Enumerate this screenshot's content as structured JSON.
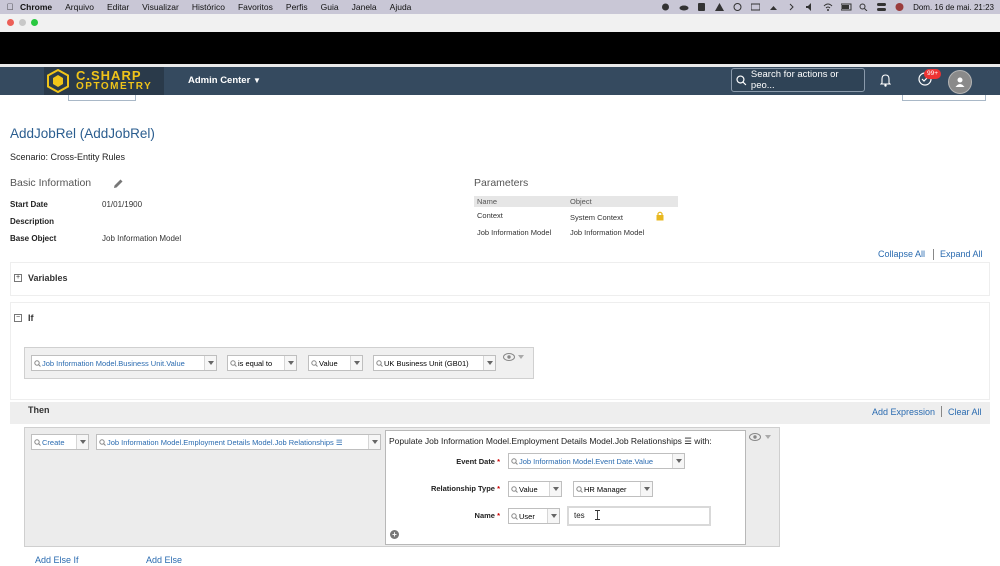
{
  "menubar": {
    "items": [
      "Chrome",
      "Arquivo",
      "Editar",
      "Visualizar",
      "Histórico",
      "Favoritos",
      "Perfis",
      "Guia",
      "Janela",
      "Ajuda"
    ],
    "clock": "Dom. 16 de mai.  21:23"
  },
  "shell": {
    "logo_line1": "C.SHARP",
    "logo_line2": "OPTOMETRY",
    "admin_center": "Admin Center",
    "search_placeholder": "Search for actions or peo...",
    "notification_badge": "99+",
    "brand_color": "#354a5f",
    "logo_color": "#f0c419"
  },
  "rule": {
    "title": "AddJobRel (AddJobRel)",
    "scenario": "Scenario: Cross-Entity Rules"
  },
  "basic_info": {
    "heading": "Basic Information",
    "start_date_label": "Start Date",
    "start_date": "01/01/1900",
    "description_label": "Description",
    "base_object_label": "Base Object",
    "base_object": "Job Information Model"
  },
  "parameters": {
    "heading": "Parameters",
    "col_name": "Name",
    "col_object": "Object",
    "rows": [
      {
        "name": "Context",
        "object": "System Context"
      },
      {
        "name": "Job Information Model",
        "object": "Job Information Model"
      }
    ]
  },
  "actions": {
    "collapse_all": "Collapse All",
    "expand_all": "Expand All",
    "add_expression": "Add Expression",
    "clear_all": "Clear All",
    "add_else_if": "Add Else If",
    "add_else": "Add Else"
  },
  "variables": {
    "label": "Variables"
  },
  "if_block": {
    "label": "If",
    "left": "Job Information Model.Business Unit.Value",
    "operator": "is equal to",
    "type": "Value",
    "right": "UK Business Unit (GB01)"
  },
  "then_block": {
    "label": "Then",
    "action": "Create",
    "target": "Job Information Model.Employment Details Model.Job Relationships ☰",
    "popup_title": "Populate Job Information Model.Employment Details Model.Job Relationships ☰ with:",
    "fields": [
      {
        "label": "Event Date",
        "value": "Job Information Model.Event Date.Value"
      },
      {
        "label": "Relationship Type",
        "type": "Value",
        "value": "HR Manager"
      },
      {
        "label": "Name",
        "type": "User",
        "value": "tes"
      }
    ]
  }
}
